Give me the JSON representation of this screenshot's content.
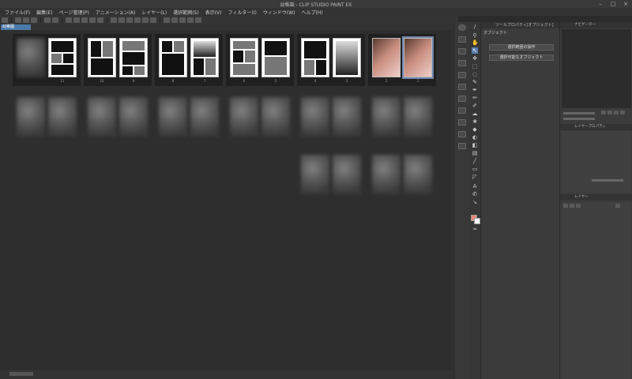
{
  "window": {
    "title": "幼稚園 - CLIP STUDIO PAINT EX"
  },
  "menu": [
    "ファイル(F)",
    "編集(E)",
    "ページ管理(P)",
    "アニメーション(A)",
    "レイヤー(L)",
    "選択範囲(S)",
    "表示(V)",
    "フィルター(I)",
    "ウィンドウ(W)",
    "ヘルプ(H)"
  ],
  "doc_tab": "幼稚園",
  "pages": [
    {
      "num": "11"
    },
    {
      "num": "10"
    },
    {
      "num": "9"
    },
    {
      "num": "8"
    },
    {
      "num": "7"
    },
    {
      "num": "6"
    },
    {
      "num": "5"
    },
    {
      "num": "4"
    },
    {
      "num": "3"
    },
    {
      "num": "2"
    },
    {
      "num": "1"
    }
  ],
  "tool_property": {
    "header": "ツールプロパティ[オブジェクト]",
    "sub_label": "オブジェクト",
    "buttons": [
      "選択範囲の操作",
      "選択可能なオブジェクト"
    ]
  },
  "right_panel": {
    "navigator_header": "ナビゲーター",
    "layer_prop_header": "レイヤープロパティ",
    "layer_header": "レイヤー"
  },
  "colors": {
    "main_color": "#f08878",
    "sub_color": "#ffffff",
    "selection": "#6f86ad"
  },
  "selected_page": "1"
}
